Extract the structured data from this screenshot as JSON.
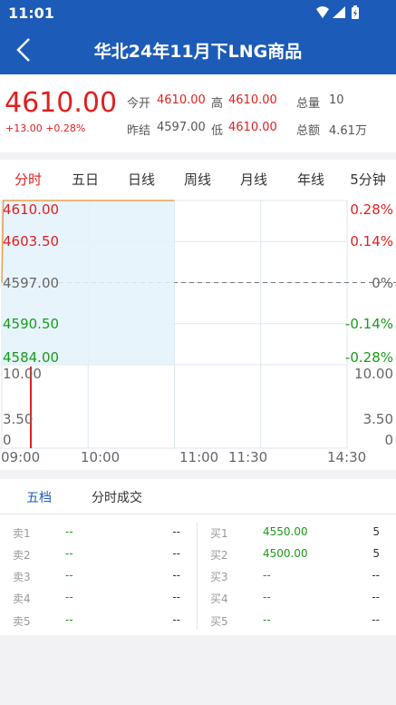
{
  "status": {
    "time": "11:01"
  },
  "header": {
    "title": "华北24年11月下LNG商品"
  },
  "quote": {
    "last_price": "4610.00",
    "change": "+13.00 +0.28%",
    "open_label": "今开",
    "open_value": "4610.00",
    "high_label": "高",
    "high_value": "4610.00",
    "volume_label": "总量",
    "volume_value": "10",
    "prev_settle_label": "昨结",
    "prev_settle_value": "4597.00",
    "low_label": "低",
    "low_value": "4610.00",
    "turnover_label": "总额",
    "turnover_value": "4.61万"
  },
  "tabs": [
    "分时",
    "五日",
    "日线",
    "周线",
    "月线",
    "年线",
    "5分钟"
  ],
  "active_tab": 0,
  "chart_data": {
    "type": "line",
    "price_ticks": [
      "4610.00",
      "4603.50",
      "4597.00",
      "4590.50",
      "4584.00"
    ],
    "pct_ticks": [
      "0.28%",
      "0.14%",
      "0%",
      "-0.14%",
      "-0.28%"
    ],
    "volume_ticks": [
      "10.00",
      "3.50",
      "0"
    ],
    "time_labels": [
      "09:00",
      "10:00",
      "11:00",
      "11:30",
      "14:30"
    ],
    "price_range": [
      4584.0,
      4610.0
    ],
    "prev_settle": 4597.0,
    "minutes_total": 240,
    "price_series": [
      {
        "t": 0,
        "price": 4597.0
      },
      {
        "t": 1,
        "price": 4610.0
      },
      {
        "t": 120,
        "price": 4610.0
      }
    ],
    "volume_bars": [
      {
        "t": 0,
        "volume": 10
      }
    ],
    "volume_max": 10,
    "colors": {
      "price_line": "#e8a04a",
      "area_fill": "#e3f2fb",
      "volume_bar": "#e02020",
      "up": "#e02020",
      "down": "#1a9a1a"
    }
  },
  "depth": {
    "tabs": [
      "五档",
      "分时成交"
    ],
    "active_tab": 0,
    "asks": [
      {
        "label": "卖1",
        "price": "--",
        "volume": "--"
      },
      {
        "label": "卖2",
        "price": "--",
        "volume": "--"
      },
      {
        "label": "卖3",
        "price": "--",
        "volume": "--"
      },
      {
        "label": "卖4",
        "price": "--",
        "volume": "--"
      },
      {
        "label": "卖5",
        "price": "--",
        "volume": "--"
      }
    ],
    "bids": [
      {
        "label": "买1",
        "price": "4550.00",
        "volume": "5"
      },
      {
        "label": "买2",
        "price": "4500.00",
        "volume": "5"
      },
      {
        "label": "买3",
        "price": "--",
        "volume": "--"
      },
      {
        "label": "买4",
        "price": "--",
        "volume": "--"
      },
      {
        "label": "买5",
        "price": "--",
        "volume": "--"
      }
    ]
  }
}
